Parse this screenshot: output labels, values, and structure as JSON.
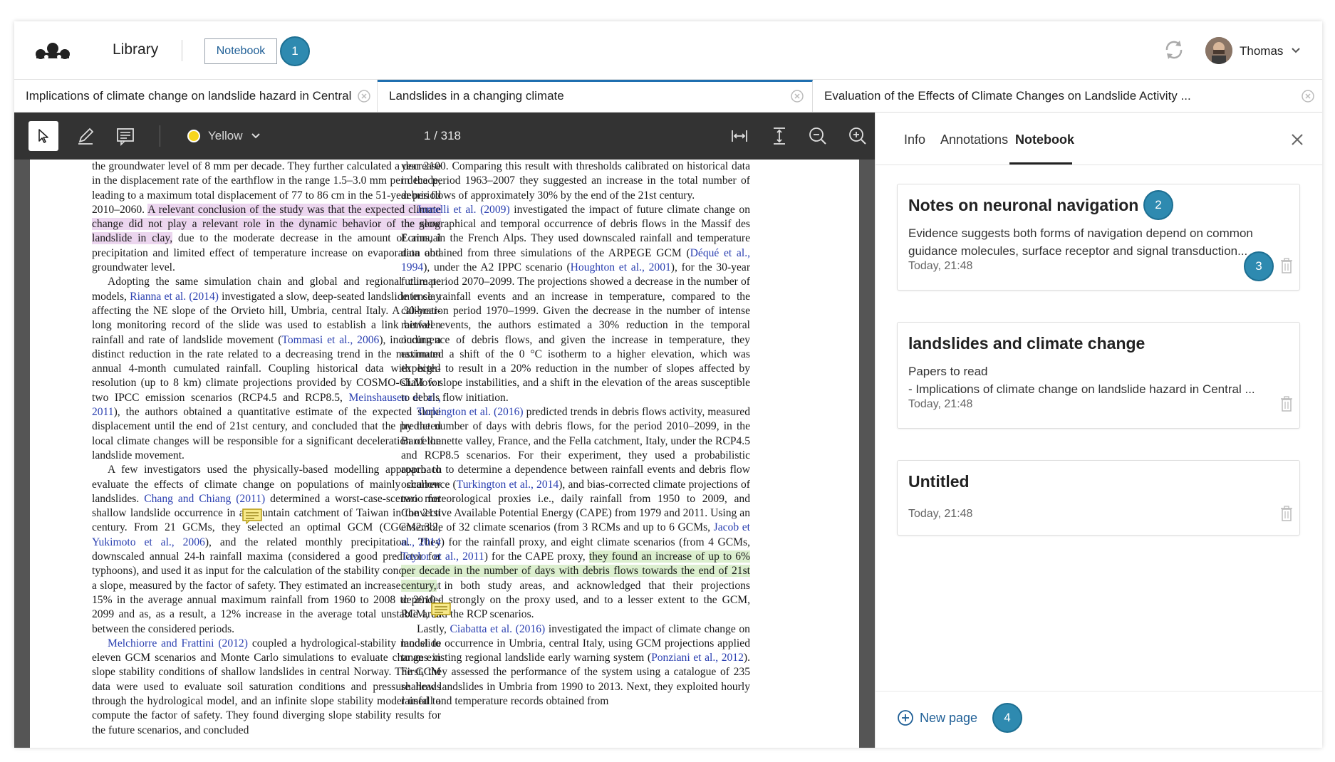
{
  "topbar": {
    "library_label": "Library",
    "notebook_button": "Notebook",
    "user_name": "Thomas",
    "icons": {
      "logo": "mendeley-logo",
      "sync": "sync-icon",
      "chevron": "chevron-down-icon"
    }
  },
  "badges": [
    "1",
    "2",
    "3",
    "4"
  ],
  "tabs": [
    {
      "label": "Implications of climate change on landslide hazard in Central Italy"
    },
    {
      "label": "Landslides in a changing climate"
    },
    {
      "label": "Evaluation of the Effects of Climate Changes on Landslide Activity ..."
    }
  ],
  "toolbar": {
    "color_label": "Yellow",
    "page_indicator": "1 / 318",
    "highlight_color": "#f7d51d"
  },
  "document": {
    "left_column": [
      "the groundwater level of 8 mm per decade. They further calculated a decrease in the displacement rate of the earthflow in the range 1.5–3.0 mm per decade, leading to a maximum total displacement of 77 to 86 cm in the 51-year period 2010–2060.",
      "A relevant conclusion of the study was that the expected climate change did not play a relevant role in the dynamic behavior of the slow landslide in clay,",
      "due to the moderate decrease in the amount of annual precipitation and limited effect of temperature increase on evaporation and groundwater level.",
      "Adopting the same simulation chain and global and regional climate models,",
      "Rianna et al. (2014)",
      "investigated a slow, deep-seated landslide in clay affecting the NE slope of the Orvieto hill, Umbria, central Italy. A 30-year-long monitoring record of the slide was used to establish a link between rainfall and rate of landslide movement (",
      "Tommasi et al., 2006",
      "), including a distinct reduction in the rate related to a decreasing trend in the maximum annual 4-month cumulated rainfall. Coupling historical data with high-resolution (up to 8 km) climate projections provided by COSMO-CLM for two IPCC emission scenarios (RCP4.5 and RCP8.5,",
      "Meinshausen et al., 2011",
      "), the authors obtained a quantitative estimate of the expected slope displacement until the end of 21st century, and concluded that the predicted local climate changes will be responsible for a significant deceleration of the landslide movement.",
      "A few investigators used the physically-based modelling approach to evaluate the effects of climate change on populations of mainly shallow landslides.",
      "Chang and Chiang (2011)",
      "determined a worst-case-scenario for shallow landslide occurrence in a mountain catchment of Taiwan in the 21st century. From 21 GCMs, they selected an optimal GCM (CGCM2.3.2,",
      "Yukimoto et al., 2006",
      "), and the related monthly precipitation. They downscaled annual 24-h rainfall maxima (considered a good predictor for typhoons), and used it as input for the calculation of the stability conditions of a slope, measured by the factor of safety. They estimated an increase of about 15% in the average annual maximum rainfall from 1960 to 2008 to 2010–2099 and as, as a result, a 12% increase in the average total unstable area between the considered periods.",
      "Melchiorre and Frattini (2012)",
      "coupled a hydrological-stability model to eleven GCM scenarios and Monte Carlo simulations to evaluate changes in slope stability conditions of shallow landslides in central Norway. The GCM data were used to evaluate soil saturation conditions and pressure heads through the hydrological model, and an infinite slope stability model used to compute the factor of safety. They found diverging slope stability results for the future scenarios, and concluded"
    ],
    "right_column": [
      "year 2100. Comparing this result with thresholds calibrated on historical data in the period 1963–2007 they suggested an increase in the total number of debris flows of approximately 30% by the end of the 21st century.",
      "Jomelli et al. (2009)",
      "investigated the impact of future climate change on the geographical and temporal occurrence of debris flows in the Massif des Ecrins, in the French Alps. They used downscaled rainfall and temperature data obtained from three simulations of the ARPEGE GCM (",
      "Déqué et al., 1994",
      "), under the A2 IPPC scenario (",
      "Houghton et al., 2001",
      "), for the 30-year future period 2070–2099. The projections showed a decrease in the number of intense rainfall events and an increase in temperature, compared to the calibration period 1970–1999. Given the decrease in the number of intense rainfall events, the authors estimated a 30% reduction in the temporal occurrence of debris flows, and given the increase in temperature, they estimated a shift of the 0 °C isotherm to a higher elevation, which was expected to result in a 20% reduction in the number of slopes affected by shallow slope instabilities, and a shift in the elevation of the areas susceptible to debris flow initiation.",
      "Turkington et al. (2016)",
      "predicted trends in debris flows activity, measured by the number of days with debris flows, for the period 2010–2099, in the Barcelonnette valley, France, and the Fella catchment, Italy, under the RCP4.5 and RCP8.5 scenarios. For their experiment, they used a probabilistic approach to determine a dependence between rainfall events and debris flow occurrence (",
      "Turkington et al., 2014",
      "), and bias-corrected climate projections of two meteorological proxies i.e., daily rainfall from 1950 to 2009, and Convective Available Potential Energy (CAPE) from 1979 and 2011. Using an ensemble of 32 climate scenarios (from 3 RCMs and up to 6 GCMs,",
      "Jacob et al., 2014",
      ") for the rainfall proxy, and eight climate scenarios (from 4 GCMs,",
      "Taylor et al., 2011",
      ") for the CAPE proxy,",
      "they found an increase of up to 6% per decade in the number of days with debris flows towards the end of 21st century,",
      "in both study areas, and acknowledged that their projections depended strongly on the proxy used, and to a lesser extent to the GCM, RCM, and the RCP scenarios.",
      "Lastly,",
      "Ciabatta et al. (2016)",
      "investigated the impact of climate change on landslide occurrence in Umbria, central Italy, using GCM projections applied to an existing regional landslide early warning system (",
      "Ponziani et al., 2012",
      "). First, they assessed the performance of the system using a catalogue of 235 shallow landslides in Umbria from 1990 to 2013. Next, they exploited hourly rainfall and temperature records obtained from"
    ]
  },
  "panel": {
    "tabs": [
      "Info",
      "Annotations",
      "Notebook"
    ],
    "active_tab": "Notebook",
    "notes": [
      {
        "title": "Notes on neuronal navigation",
        "body": "Evidence suggests both forms of navigation depend on common guidance molecules, surface receptor and signal transduction...",
        "time": "Today, 21:48"
      },
      {
        "title": "landslides and climate change",
        "body_line1": "Papers to read",
        "body_line2": "- Implications of climate change on landslide hazard in Central ...",
        "time": "Today, 21:48"
      },
      {
        "title": "Untitled",
        "time": "Today, 21:48"
      }
    ],
    "new_page_label": "New page"
  }
}
